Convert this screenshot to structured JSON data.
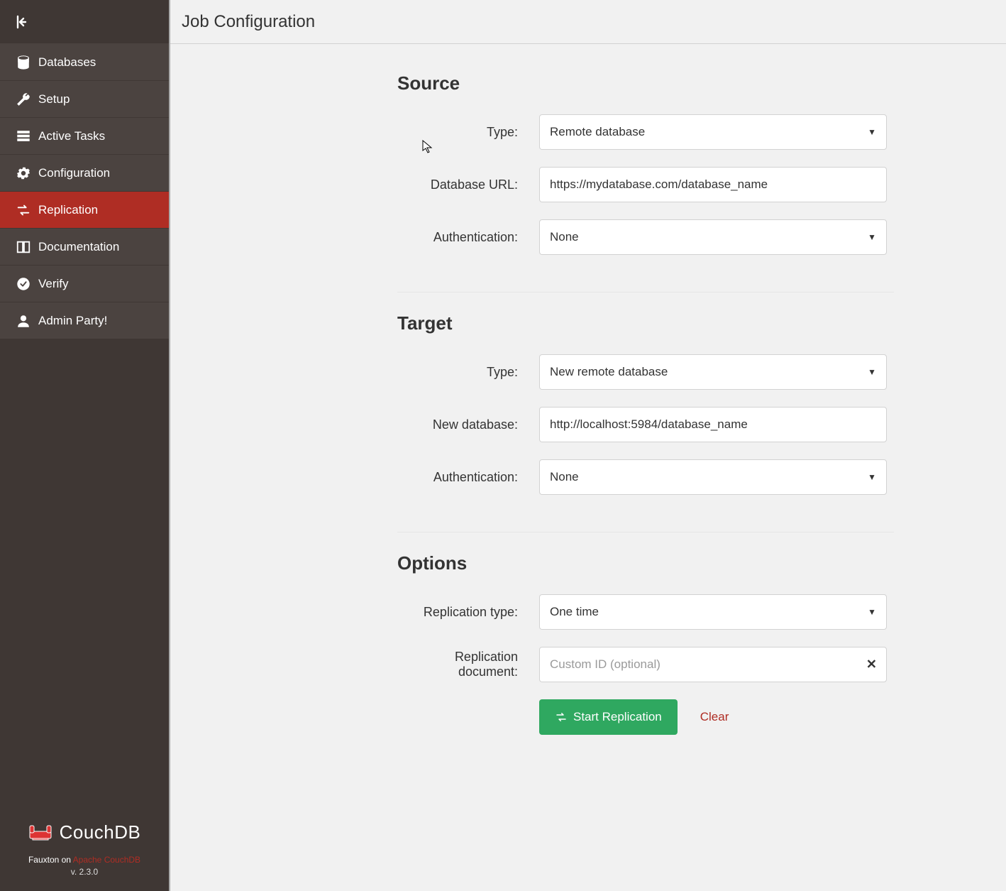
{
  "sidebar": {
    "items": [
      {
        "label": "Databases",
        "icon": "database-icon"
      },
      {
        "label": "Setup",
        "icon": "wrench-icon"
      },
      {
        "label": "Active Tasks",
        "icon": "tasks-icon"
      },
      {
        "label": "Configuration",
        "icon": "gear-icon"
      },
      {
        "label": "Replication",
        "icon": "exchange-icon",
        "active": true
      },
      {
        "label": "Documentation",
        "icon": "book-icon"
      },
      {
        "label": "Verify",
        "icon": "check-circle-icon"
      },
      {
        "label": "Admin Party!",
        "icon": "user-icon"
      }
    ],
    "logo_text": "CouchDB",
    "footer_prefix": "Fauxton on ",
    "footer_link": "Apache CouchDB",
    "version": "v. 2.3.0"
  },
  "header": {
    "title": "Job Configuration"
  },
  "source_section": {
    "title": "Source",
    "type_label": "Type:",
    "type_value": "Remote database",
    "url_label": "Database URL:",
    "url_value": "https://mydatabase.com/database_name",
    "auth_label": "Authentication:",
    "auth_value": "None"
  },
  "target_section": {
    "title": "Target",
    "type_label": "Type:",
    "type_value": "New remote database",
    "newdb_label": "New database:",
    "newdb_value": "http://localhost:5984/database_name",
    "auth_label": "Authentication:",
    "auth_value": "None"
  },
  "options_section": {
    "title": "Options",
    "rep_type_label": "Replication type:",
    "rep_type_value": "One time",
    "rep_doc_label": "Replication document:",
    "rep_doc_placeholder": "Custom ID (optional)"
  },
  "actions": {
    "start": "Start Replication",
    "clear": "Clear"
  }
}
